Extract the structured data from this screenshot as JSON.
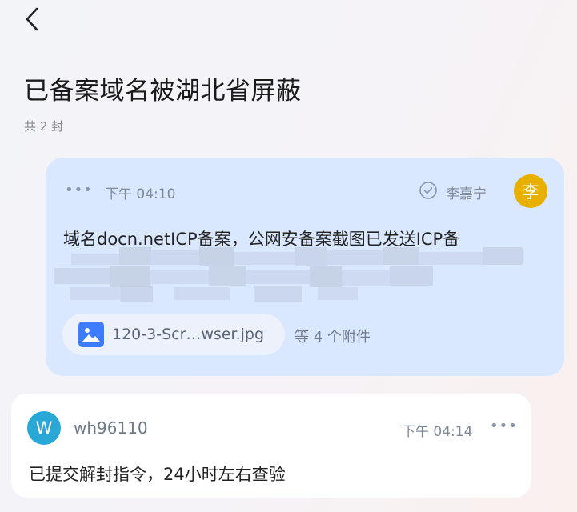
{
  "header": {
    "back_icon": "chevron-left-icon",
    "title": "已备案域名被湖北省屏蔽",
    "count": "共 2 封"
  },
  "messages": [
    {
      "more": "•••",
      "time": "下午 04:10",
      "status_icon": "check-circle-icon",
      "sender": "李嘉宁",
      "avatar_letter": "李",
      "avatar_color": "#e8b000",
      "body": "域名docn.netICP备案，公网安备案截图已发送ICP备",
      "attachment": {
        "icon": "image-icon",
        "name": "120-3-Scr…wser.jpg",
        "more": "等 4 个附件"
      }
    },
    {
      "avatar_letter": "W",
      "avatar_color": "#29a8d5",
      "sender": "wh96110",
      "time": "下午 04:14",
      "more": "•••",
      "body": "已提交解封指令，24小时左右查验"
    }
  ],
  "colors": {
    "card_highlight": "#d9e7ff",
    "card_normal": "#ffffff",
    "accent_blue": "#3d7bff"
  }
}
